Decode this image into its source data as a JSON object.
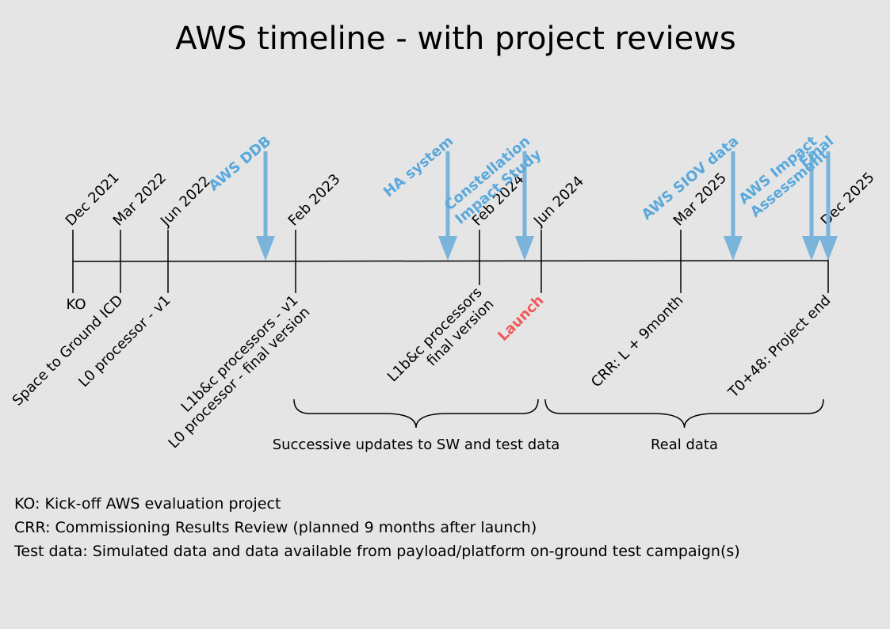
{
  "title": "AWS timeline - with project reviews",
  "colors": {
    "review": "#5aa8dc",
    "review_arrow": "#7ab4da",
    "launch": "#f05a5a",
    "line": "#000000",
    "background": "#e5e5e5"
  },
  "dates": [
    "Dec 2021",
    "Mar 2022",
    "Jun 2022",
    "Feb 2023",
    "Feb 2024",
    "Jun 2024",
    "Mar 2025",
    "Dec 2025"
  ],
  "milestones": [
    {
      "lines": [
        "KO"
      ]
    },
    {
      "lines": [
        "Space to Ground ICD"
      ]
    },
    {
      "lines": [
        "L0 processor - v1"
      ]
    },
    {
      "lines": [
        "L1b&c processors - v1",
        "L0 processor - final version"
      ]
    },
    {
      "lines": [
        "L1b&c processors",
        "final version"
      ]
    },
    {
      "lines": [
        "Launch"
      ],
      "highlight": true
    },
    {
      "lines": [
        "CRR: L + 9month"
      ]
    },
    {
      "lines": [
        "T0+48: Project end"
      ]
    }
  ],
  "reviews": [
    {
      "lines": [
        "AWS DDB"
      ]
    },
    {
      "lines": [
        "HA system"
      ]
    },
    {
      "lines": [
        "Constellation",
        "Impact Study"
      ]
    },
    {
      "lines": [
        "AWS SIOV data"
      ]
    },
    {
      "lines": [
        "AWS Impact",
        "Assessment"
      ]
    },
    {
      "lines": [
        "Final"
      ]
    }
  ],
  "phases": [
    {
      "label": "Successive updates to SW and test data"
    },
    {
      "label": "Real data"
    }
  ],
  "notes": [
    "KO: Kick-off AWS evaluation project",
    "CRR: Commissioning Results Review (planned 9 months after launch)",
    "Test data: Simulated data and data available from payload/platform on-ground test campaign(s)"
  ]
}
